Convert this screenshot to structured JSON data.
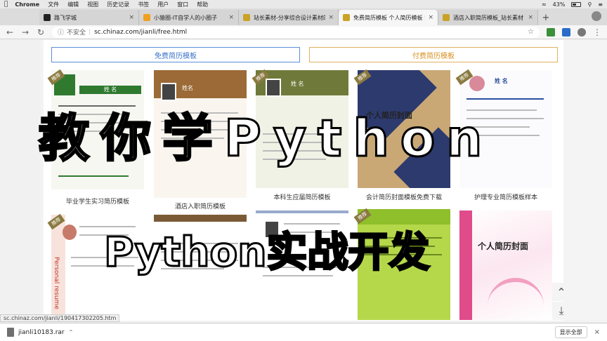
{
  "menubar": {
    "app": "Chrome",
    "items": [
      "文件",
      "编辑",
      "视图",
      "历史记录",
      "书签",
      "用户",
      "窗口",
      "帮助"
    ],
    "battery": "43%"
  },
  "tabs": [
    {
      "label": "路飞学城",
      "color": "#222222"
    },
    {
      "label": "小猿圈-IT自学人的小圈子",
      "color": "#f0a020"
    },
    {
      "label": "站长素材-分享综合设计素材的平台",
      "color": "#c9a227"
    },
    {
      "label": "免费简历模板 个人简历模板 简历",
      "color": "#c9a227"
    },
    {
      "label": "酒店入职简历模板_站长素材",
      "color": "#c9a227"
    }
  ],
  "toolbar": {
    "insecure": "不安全",
    "url": "sc.chinaz.com/jianli/free.html"
  },
  "filters": {
    "free": "免费简历模板",
    "paid": "付费简历模板"
  },
  "cards_row1": [
    {
      "caption": "毕业学生实习简历模板",
      "header": "姓 名",
      "accent": "#2f7a2f"
    },
    {
      "caption": "酒店入职简历模板",
      "header": "姓名",
      "accent": "#9b6a36"
    },
    {
      "caption": "本科生应届简历模板",
      "header": "姓 名",
      "accent": "#6f7a3a"
    },
    {
      "caption": "会计简历封面模板免费下载",
      "header": "个人简历封面",
      "accent": "#2d3a6e"
    },
    {
      "caption": "护理专业简历模板样本",
      "header": "姓 名",
      "accent": "#2a4fa0"
    }
  ],
  "cards_row2": [
    {
      "header": "Personal resume",
      "accent": "#c0392b"
    },
    {
      "header": "",
      "accent": "#7a5a36"
    },
    {
      "header": "",
      "accent": "#555555"
    },
    {
      "header": "",
      "accent": "#8fbf2a"
    },
    {
      "header": "个人简历封面",
      "accent": "#e04b8a"
    }
  ],
  "badge": "推荐",
  "overlay": {
    "title": "教你学Python",
    "subtitle": "Python实战开发"
  },
  "status_url": "sc.chinaz.com/jianli/190417302205.htm",
  "download": {
    "file": "jianli10183.rar",
    "show_all": "显示全部"
  }
}
